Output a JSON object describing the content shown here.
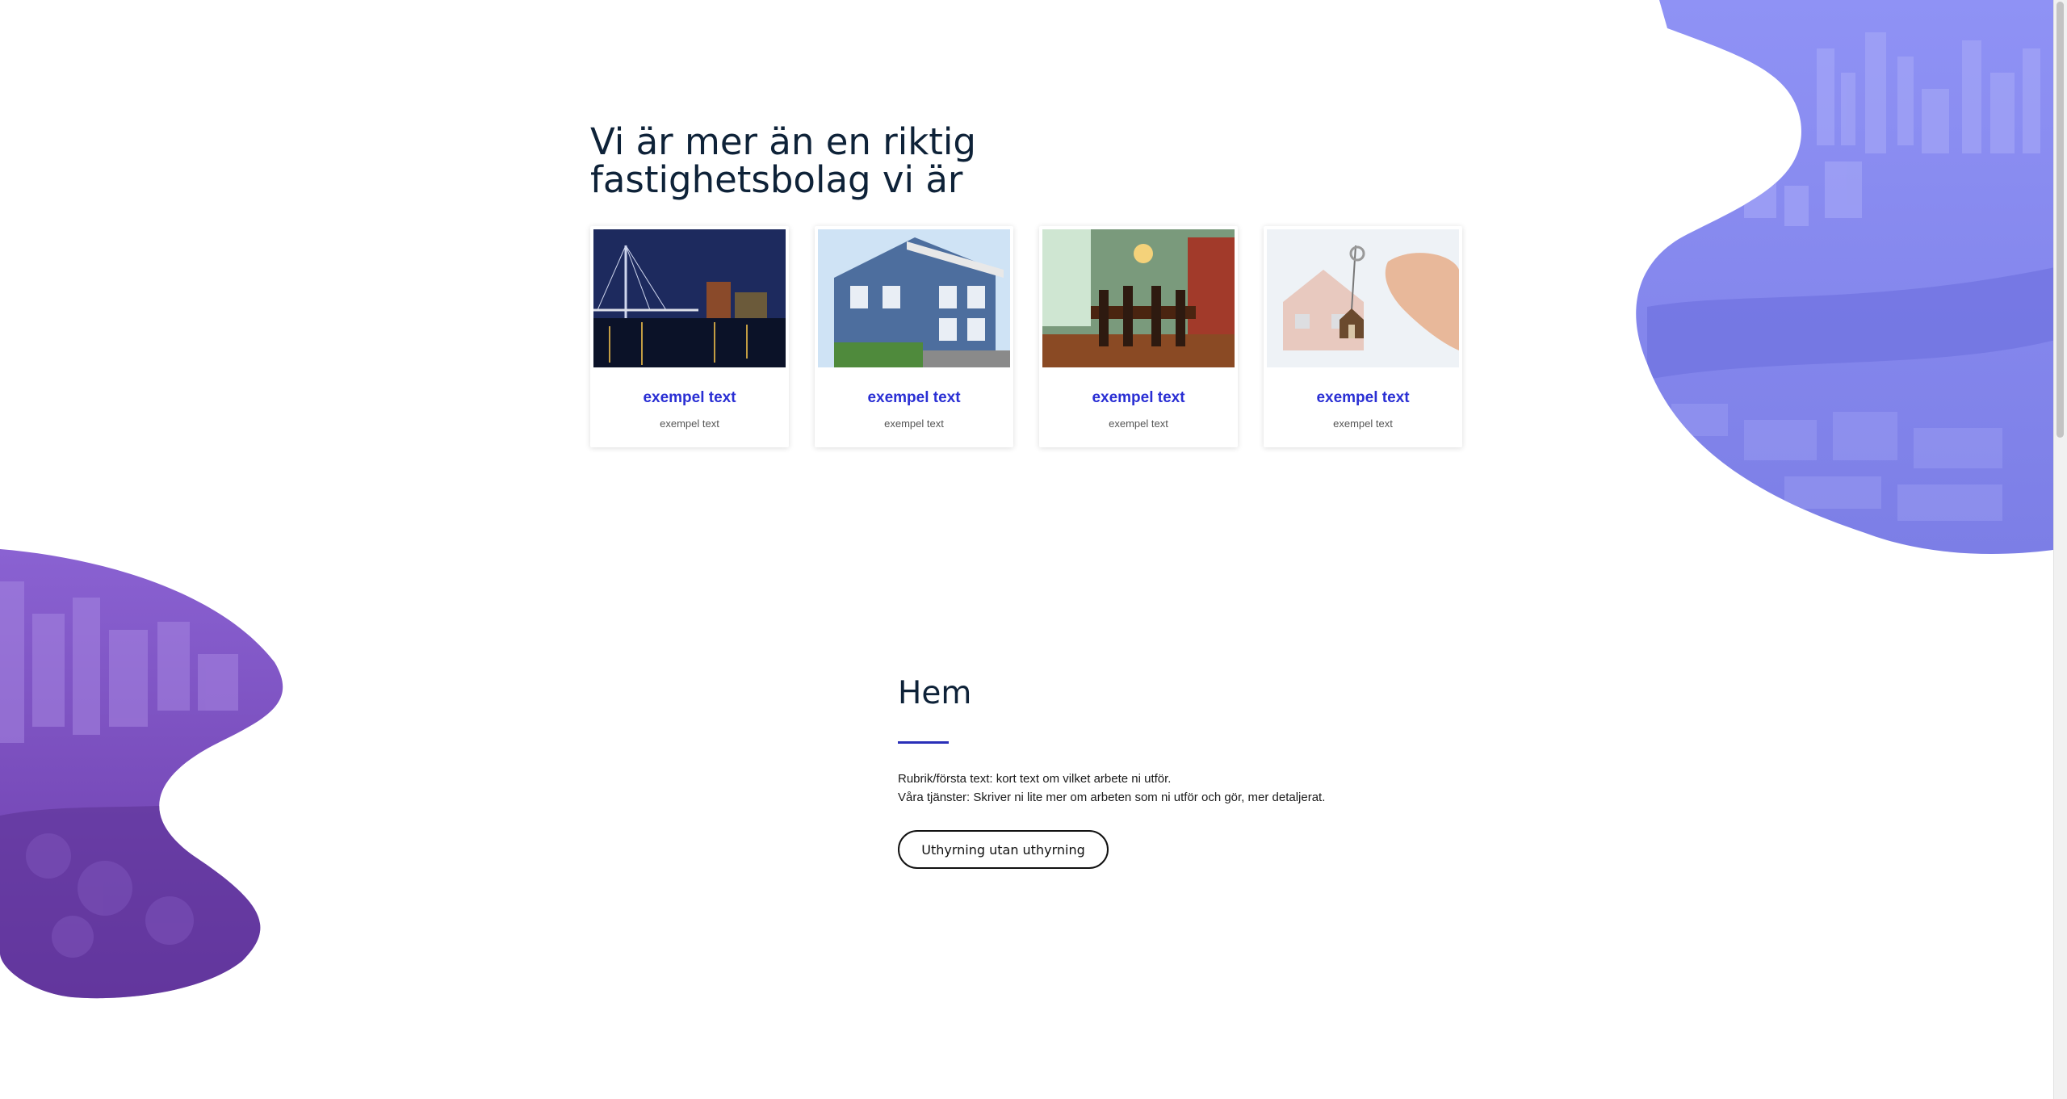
{
  "hero": {
    "headline": "Vi är mer än en riktig fastighetsbolag vi är"
  },
  "cards": [
    {
      "image": "bridge-night-photo",
      "title": "exempel text",
      "subtitle": "exempel text"
    },
    {
      "image": "blue-house-photo",
      "title": "exempel text",
      "subtitle": "exempel text"
    },
    {
      "image": "dining-room-photo",
      "title": "exempel text",
      "subtitle": "exempel text"
    },
    {
      "image": "house-keys-photo",
      "title": "exempel text",
      "subtitle": "exempel text"
    }
  ],
  "about": {
    "heading": "Hem",
    "line1": "Rubrik/första text: kort text om vilket arbete ni utför.",
    "line2": "Våra tjänster: Skriver ni lite mer om arbeten som ni utför och gör, mer detaljerat.",
    "button_label": "Uthyrning utan uthyrning"
  },
  "colors": {
    "accent": "#2a2fd4",
    "blob_top": "#8b8cf0",
    "blob_left": "#7a4cc0",
    "heading": "#0e2238"
  }
}
